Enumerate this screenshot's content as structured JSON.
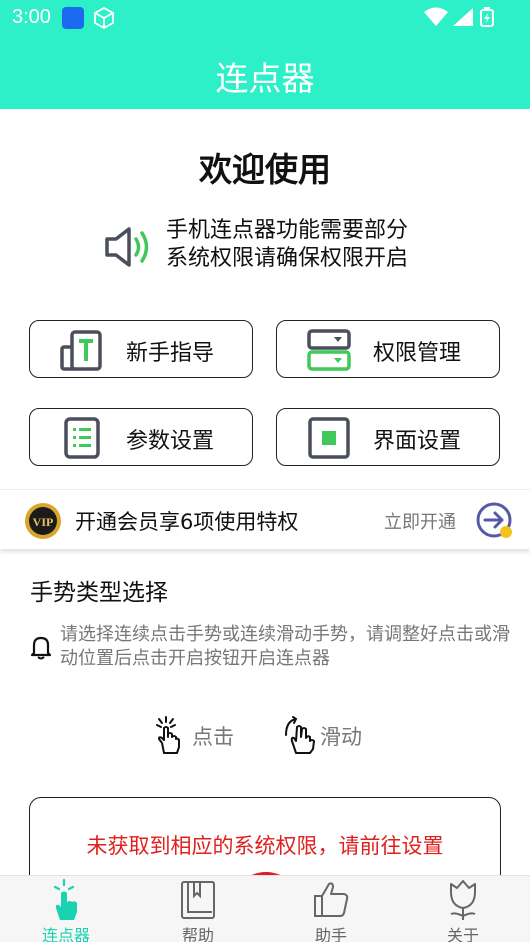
{
  "status_bar": {
    "time": "3:00",
    "icons": [
      "app-icon",
      "cube-icon",
      "wifi-icon",
      "signal-icon",
      "battery-icon"
    ]
  },
  "app_bar": {
    "title": "连点器"
  },
  "welcome": {
    "title": "欢迎使用"
  },
  "notice": {
    "line1": "手机连点器功能需要部分",
    "line2": "系统权限请确保权限开启",
    "icon": "speaker-icon"
  },
  "actions": [
    {
      "label": "新手指导",
      "icon": "guide-icon"
    },
    {
      "label": "权限管理",
      "icon": "permission-icon"
    },
    {
      "label": "参数设置",
      "icon": "list-icon"
    },
    {
      "label": "界面设置",
      "icon": "square-icon"
    }
  ],
  "vip": {
    "badge": "VIP",
    "text": "开通会员享6项使用特权",
    "action": "立即开通"
  },
  "gesture_section": {
    "title": "手势类型选择",
    "hint": "请选择连续点击手势或连续滑动手势，请调整好点击或滑动位置后点击开启按钮开启连点器",
    "options": [
      {
        "label": "点击",
        "icon": "tap-hand-icon"
      },
      {
        "label": "滑动",
        "icon": "swipe-hand-icon"
      }
    ]
  },
  "permission": {
    "message": "未获取到相应的系统权限，请前往设置"
  },
  "bottom_nav": [
    {
      "label": "连点器",
      "active": true
    },
    {
      "label": "帮助",
      "active": false
    },
    {
      "label": "助手",
      "active": false
    },
    {
      "label": "关于",
      "active": false
    }
  ],
  "colors": {
    "accent": "#2ef0c8",
    "accent_text": "#19d2b0",
    "icon_green": "#3ec95a",
    "icon_dark": "#4a4f5c",
    "warning": "#e0201c"
  }
}
